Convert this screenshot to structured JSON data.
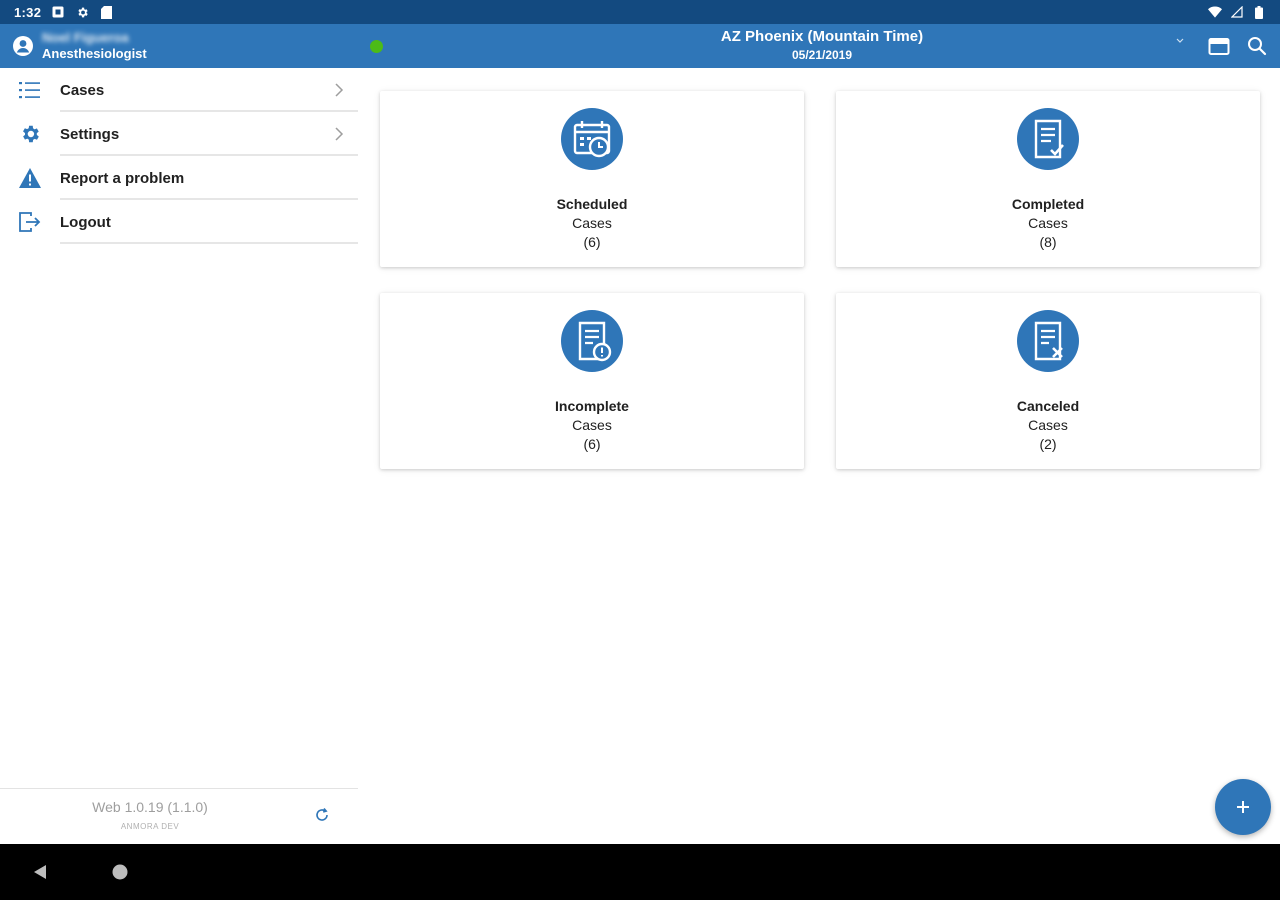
{
  "status_bar": {
    "time": "1:32"
  },
  "header": {
    "user_name": "Noel Figueroa",
    "user_role": "Anesthesiologist",
    "location": "AZ Phoenix (Mountain Time)",
    "date": "05/21/2019",
    "online_color": "#4cbb17"
  },
  "sidebar": {
    "items": [
      {
        "label": "Cases",
        "icon": "list-icon",
        "has_chevron": true
      },
      {
        "label": "Settings",
        "icon": "gear-icon",
        "has_chevron": true
      },
      {
        "label": "Report a problem",
        "icon": "warning-icon",
        "has_chevron": false
      },
      {
        "label": "Logout",
        "icon": "logout-icon",
        "has_chevron": false
      }
    ],
    "version": "Web 1.0.19 (1.1.0)",
    "environment": "ANMORA DEV"
  },
  "cards": [
    {
      "title": "Scheduled",
      "subtitle": "Cases",
      "count": "(6)",
      "icon": "calendar-clock-icon"
    },
    {
      "title": "Completed",
      "subtitle": "Cases",
      "count": "(8)",
      "icon": "document-check-icon"
    },
    {
      "title": "Incomplete",
      "subtitle": "Cases",
      "count": "(6)",
      "icon": "document-alert-icon"
    },
    {
      "title": "Canceled",
      "subtitle": "Cases",
      "count": "(2)",
      "icon": "document-cancel-icon"
    }
  ],
  "colors": {
    "primary": "#2f76b8",
    "status_bar": "#134a80"
  }
}
